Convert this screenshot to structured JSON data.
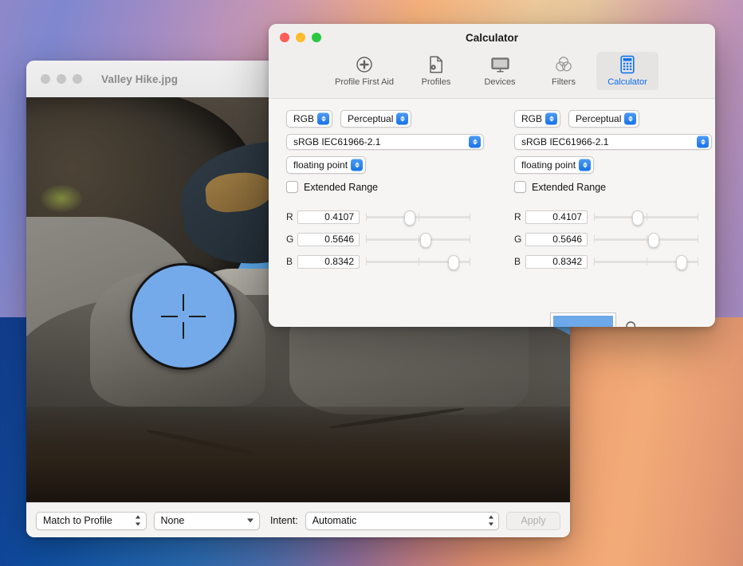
{
  "viewer": {
    "title": "Valley Hike.jpg",
    "traffic_lights": [
      "close",
      "minimize",
      "zoom"
    ],
    "bottom_bar": {
      "match_popup": "Match to Profile",
      "profile_popup": "None",
      "intent_label": "Intent:",
      "intent_popup": "Automatic",
      "apply_button": "Apply"
    },
    "loupe": {
      "sampled_color": "#74aaea"
    }
  },
  "calculator": {
    "title": "Calculator",
    "traffic_lights": {
      "close": "#ff5f57",
      "minimize": "#febc2e",
      "zoom": "#28c840"
    },
    "toolbar": {
      "items": [
        {
          "label": "Profile First Aid",
          "icon": "plus-circle-icon",
          "selected": false
        },
        {
          "label": "Profiles",
          "icon": "document-gear-icon",
          "selected": false
        },
        {
          "label": "Devices",
          "icon": "display-icon",
          "selected": false
        },
        {
          "label": "Filters",
          "icon": "venn-circles-icon",
          "selected": false
        },
        {
          "label": "Calculator",
          "icon": "calculator-icon",
          "selected": true
        }
      ],
      "selected_color": "#0a6cf1"
    },
    "panels": [
      {
        "side": "left",
        "color_space": "RGB",
        "rendering_intent": "Perceptual",
        "profile": "sRGB IEC61966-2.1",
        "number_format": "floating point",
        "extended_range_label": "Extended Range",
        "extended_range_checked": false,
        "channels": [
          {
            "name": "R",
            "value": "0.4107",
            "position_pct": 41.07
          },
          {
            "name": "G",
            "value": "0.5646",
            "position_pct": 56.46
          },
          {
            "name": "B",
            "value": "0.8342",
            "position_pct": 83.42
          }
        ],
        "swatch_color": "#6da8e8",
        "has_magnifier": true
      },
      {
        "side": "right",
        "color_space": "RGB",
        "rendering_intent": "Perceptual",
        "profile": "sRGB IEC61966-2.1",
        "number_format": "floating point",
        "extended_range_label": "Extended Range",
        "extended_range_checked": false,
        "channels": [
          {
            "name": "R",
            "value": "0.4107",
            "position_pct": 41.07
          },
          {
            "name": "G",
            "value": "0.5646",
            "position_pct": 56.46
          },
          {
            "name": "B",
            "value": "0.8342",
            "position_pct": 83.42
          }
        ],
        "swatch_color": "#6da8e8",
        "has_magnifier": false
      }
    ],
    "transfer_arrow": "arrow-left-icon"
  }
}
